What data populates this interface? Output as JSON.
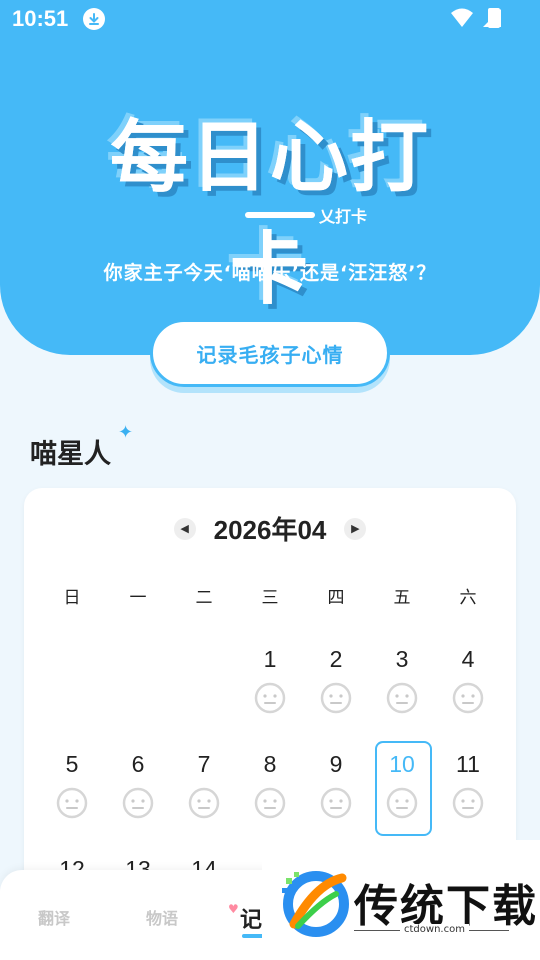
{
  "status": {
    "time": "10:51"
  },
  "colors": {
    "accent": "#45b9f7",
    "background": "#eef7fd"
  },
  "header": {
    "logo_text": "每日心打卡",
    "logo_sub": "乂打卡",
    "tagline": "你家主子今天‘喵喵乐’还是‘汪汪怒’？"
  },
  "record_button": {
    "label": "记录毛孩子心情"
  },
  "pet": {
    "title": "喵星人"
  },
  "calendar": {
    "month_label": "2026年04",
    "weekdays": [
      "日",
      "一",
      "二",
      "三",
      "四",
      "五",
      "六"
    ],
    "today": "10",
    "rows": [
      [
        "",
        "",
        "",
        "1",
        "2",
        "3",
        "4"
      ],
      [
        "5",
        "6",
        "7",
        "8",
        "9",
        "10",
        "11"
      ],
      [
        "12",
        "13",
        "14",
        "",
        "",
        "",
        ""
      ]
    ]
  },
  "tabs": [
    {
      "label": "翻译"
    },
    {
      "label": "物语"
    },
    {
      "label": "记"
    }
  ],
  "watermark": {
    "text": "传统下载",
    "url": "ctdown.com"
  }
}
